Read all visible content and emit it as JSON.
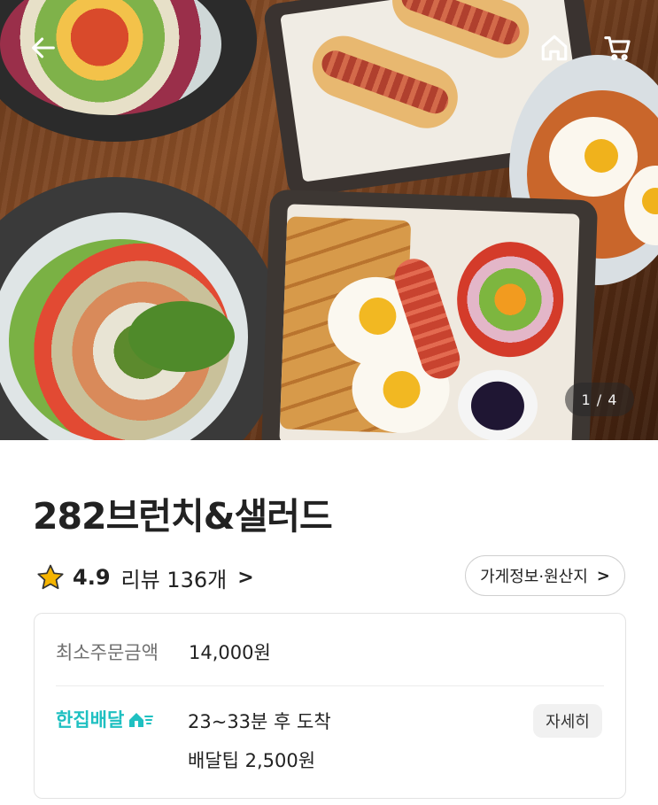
{
  "hero": {
    "page_indicator": "1 / 4",
    "back_icon": "back-arrow-icon",
    "home_icon": "home-icon",
    "cart_icon": "cart-icon"
  },
  "store": {
    "name": "282브런치&샐러드",
    "rating": "4.9",
    "review_label": "리뷰 136개",
    "info_button": "가게정보·원산지",
    "star_color": "#f5b400"
  },
  "order_card": {
    "min_order_label": "최소주문금액",
    "min_order_value": "14,000원",
    "delivery_brand": "한집배달",
    "delivery_eta": "23~33분 후 도착",
    "delivery_tip": "배달팁 2,500원",
    "detail_button": "자세히",
    "brand_color": "#1fc0c1"
  }
}
